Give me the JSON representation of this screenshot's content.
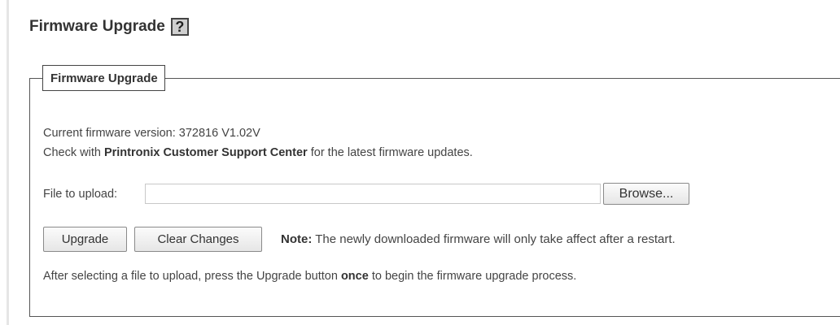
{
  "header": {
    "title": "Firmware Upgrade",
    "help_icon": "?"
  },
  "section": {
    "legend": "Firmware Upgrade",
    "version_label": "Current firmware version:",
    "version_value": "372816 V1.02V",
    "check_prefix": "Check with",
    "support_center": "Printronix Customer Support Center",
    "check_suffix": "for the latest firmware updates.",
    "file_label": "File to upload:",
    "file_value": "",
    "browse_label": "Browse..."
  },
  "actions": {
    "upgrade_label": "Upgrade",
    "clear_label": "Clear Changes",
    "note_label": "Note:",
    "note_text": "The newly downloaded firmware will only take affect after a restart."
  },
  "instructions": {
    "prefix": "After selecting a file to upload, press the Upgrade button",
    "emphasis": "once",
    "suffix": "to begin the firmware upgrade process."
  }
}
